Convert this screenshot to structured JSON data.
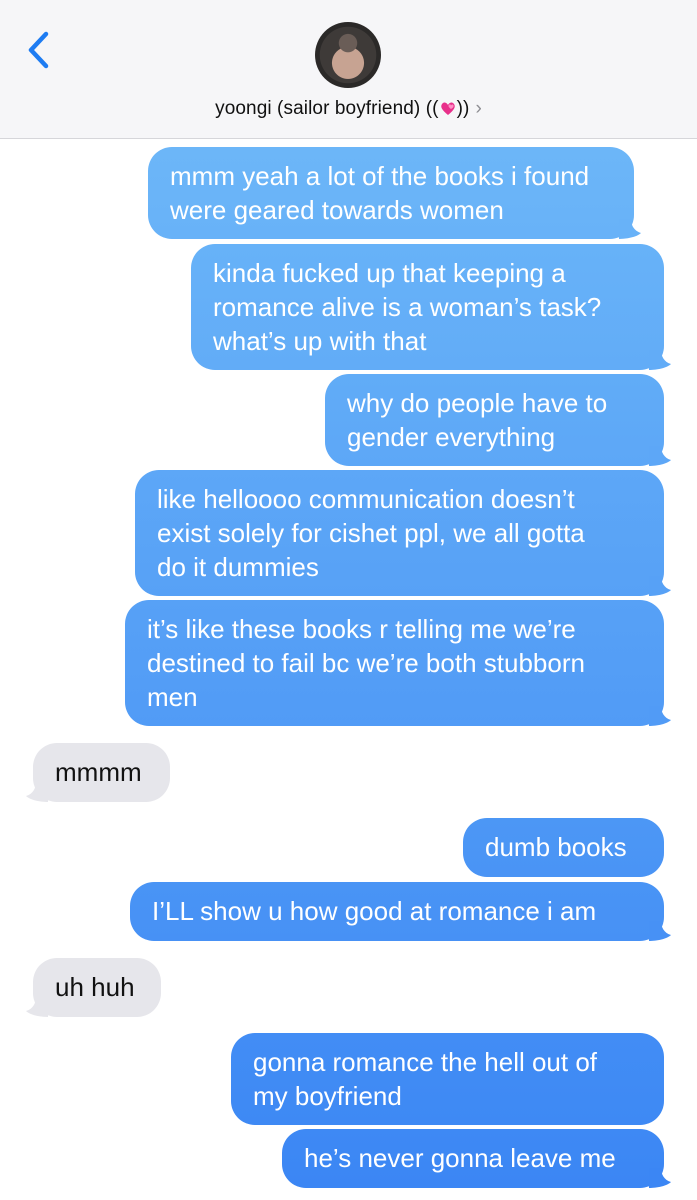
{
  "header": {
    "contact_name": "yoongi (sailor boyfriend) ((",
    "contact_suffix": "))",
    "heart_icon": "two-hearts-emoji",
    "chevron": "›"
  },
  "colors": {
    "sent_top": "#6cb6f8",
    "sent_bottom": "#3b86f4",
    "received": "#e6e6eb",
    "ios_blue": "#1e7cf2"
  },
  "messages": [
    {
      "dir": "out",
      "lines": [
        "mmm yeah a lot of the books i found",
        "were geared towards women"
      ]
    },
    {
      "dir": "out",
      "lines": [
        "kinda fucked up that keeping a",
        "romance alive is a woman’s task?",
        "what’s up with that"
      ]
    },
    {
      "dir": "out",
      "lines": [
        "why do people have to",
        "gender everything"
      ]
    },
    {
      "dir": "out",
      "lines": [
        "like helloooo communication doesn’t",
        "exist solely for cishet ppl, we all gotta",
        "do it dummies"
      ]
    },
    {
      "dir": "out",
      "lines": [
        "it’s like these books r telling me we’re",
        "destined to fail bc we’re both stubborn",
        "men"
      ]
    },
    {
      "dir": "in",
      "lines": [
        "mmmm"
      ]
    },
    {
      "dir": "out",
      "lines": [
        "dumb books"
      ]
    },
    {
      "dir": "out",
      "lines": [
        "I’LL show u how good at romance i am"
      ]
    },
    {
      "dir": "in",
      "lines": [
        "uh huh"
      ]
    },
    {
      "dir": "out",
      "lines": [
        "gonna romance the hell out of",
        "my boyfriend"
      ]
    },
    {
      "dir": "out",
      "lines": [
        "he’s never gonna leave me"
      ]
    }
  ]
}
